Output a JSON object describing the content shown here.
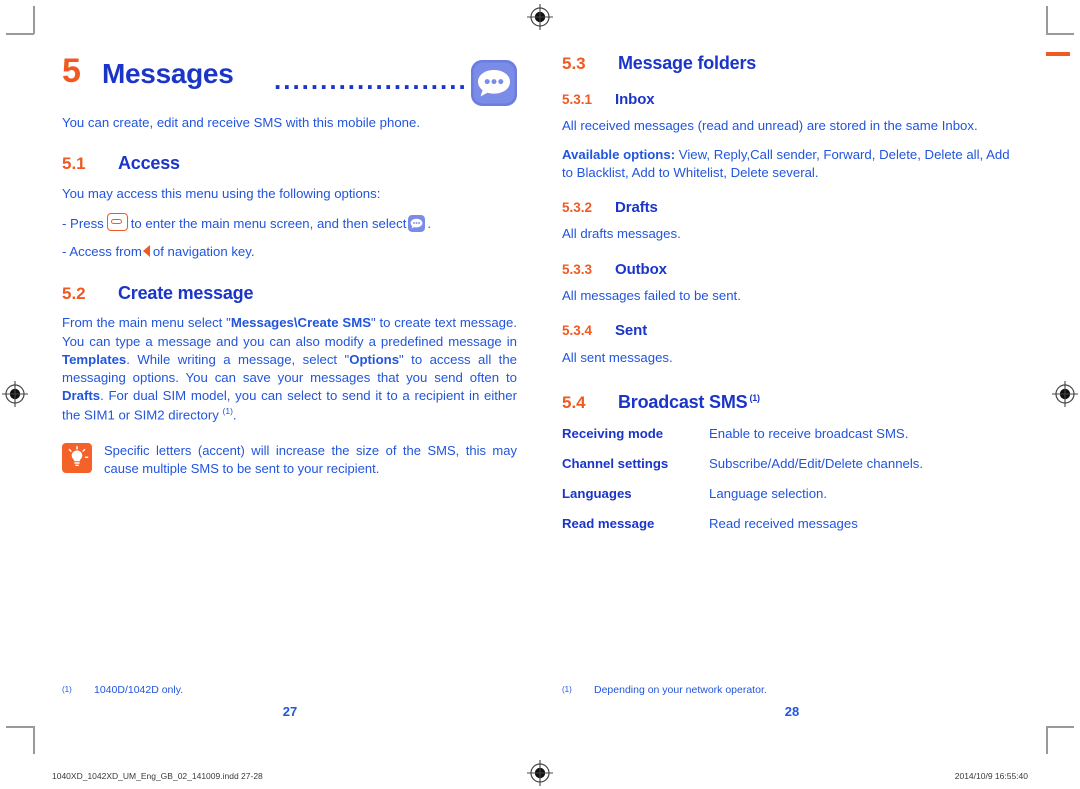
{
  "chapter": {
    "number": "5",
    "title": "Messages",
    "dots": "...........................",
    "icon": "messages-app-icon",
    "intro": "You can create, edit and receive SMS with this mobile phone."
  },
  "left_column": {
    "access": {
      "number": "5.1",
      "title": "Access",
      "intro": "You may access this menu using the following options:",
      "option_1_prefix": "- Press",
      "option_1_middle": "to enter the main menu screen, and then select",
      "option_1_suffix": ".",
      "option_2_prefix": "- Access from",
      "option_2_suffix": "of navigation key."
    },
    "create_message": {
      "number": "5.2",
      "title": "Create message",
      "paragraph": {
        "p1": "From the main menu select \"",
        "b1": "Messages\\Create SMS",
        "p2": "\" to create text message. You can type a message and you can also modify a predefined message in ",
        "b2": "Templates",
        "p3": ". While writing a message, select \"",
        "b3": "Options",
        "p4": "\" to access all the messaging options. You can save your messages that you send often to ",
        "b4": "Drafts",
        "p5": ". For dual SIM model, you can select to send it to a recipient in either the SIM1 or SIM2 directory ",
        "sup": "(1)",
        "p6": "."
      }
    },
    "tip": {
      "icon": "lightbulb-tip-icon",
      "text": "Specific letters (accent) will increase the size of the SMS, this may cause multiple SMS to be sent to your recipient."
    },
    "footnote": {
      "mark": "(1)",
      "text": "1040D/1042D only."
    },
    "page_number": "27"
  },
  "right_column": {
    "message_folders": {
      "number": "5.3",
      "title": "Message folders"
    },
    "inbox": {
      "number": "5.3.1",
      "title": "Inbox",
      "text": "All received messages (read and unread) are stored in the same Inbox.",
      "options_label": "Available options:",
      "options_text": " View, Reply,Call sender, Forward, Delete, Delete all, Add to Blacklist, Add to Whitelist, Delete several."
    },
    "drafts": {
      "number": "5.3.2",
      "title": "Drafts",
      "text": "All drafts messages."
    },
    "outbox": {
      "number": "5.3.3",
      "title": "Outbox",
      "text": "All messages failed to be sent."
    },
    "sent": {
      "number": "5.3.4",
      "title": "Sent",
      "text": "All sent messages."
    },
    "broadcast_sms": {
      "number": "5.4",
      "title": "Broadcast SMS",
      "sup": "(1)",
      "rows": [
        {
          "term": "Receiving mode",
          "desc": "Enable to receive broadcast SMS."
        },
        {
          "term": "Channel settings",
          "desc": "Subscribe/Add/Edit/Delete channels."
        },
        {
          "term": "Languages",
          "desc": "Language selection."
        },
        {
          "term": "Read message",
          "desc": "Read received messages"
        }
      ]
    },
    "footnote": {
      "mark": "(1)",
      "text": "Depending on your network operator."
    },
    "page_number": "28"
  },
  "print_slug": {
    "filename": "1040XD_1042XD_UM_Eng_GB_02_141009.indd   27-28",
    "timestamp": "2014/10/9   16:55:40"
  },
  "colors": {
    "orange": "#f05a22",
    "heading_blue": "#1b35c8",
    "body_blue": "#2255dd",
    "icon_blue": "#5b6fd8"
  }
}
